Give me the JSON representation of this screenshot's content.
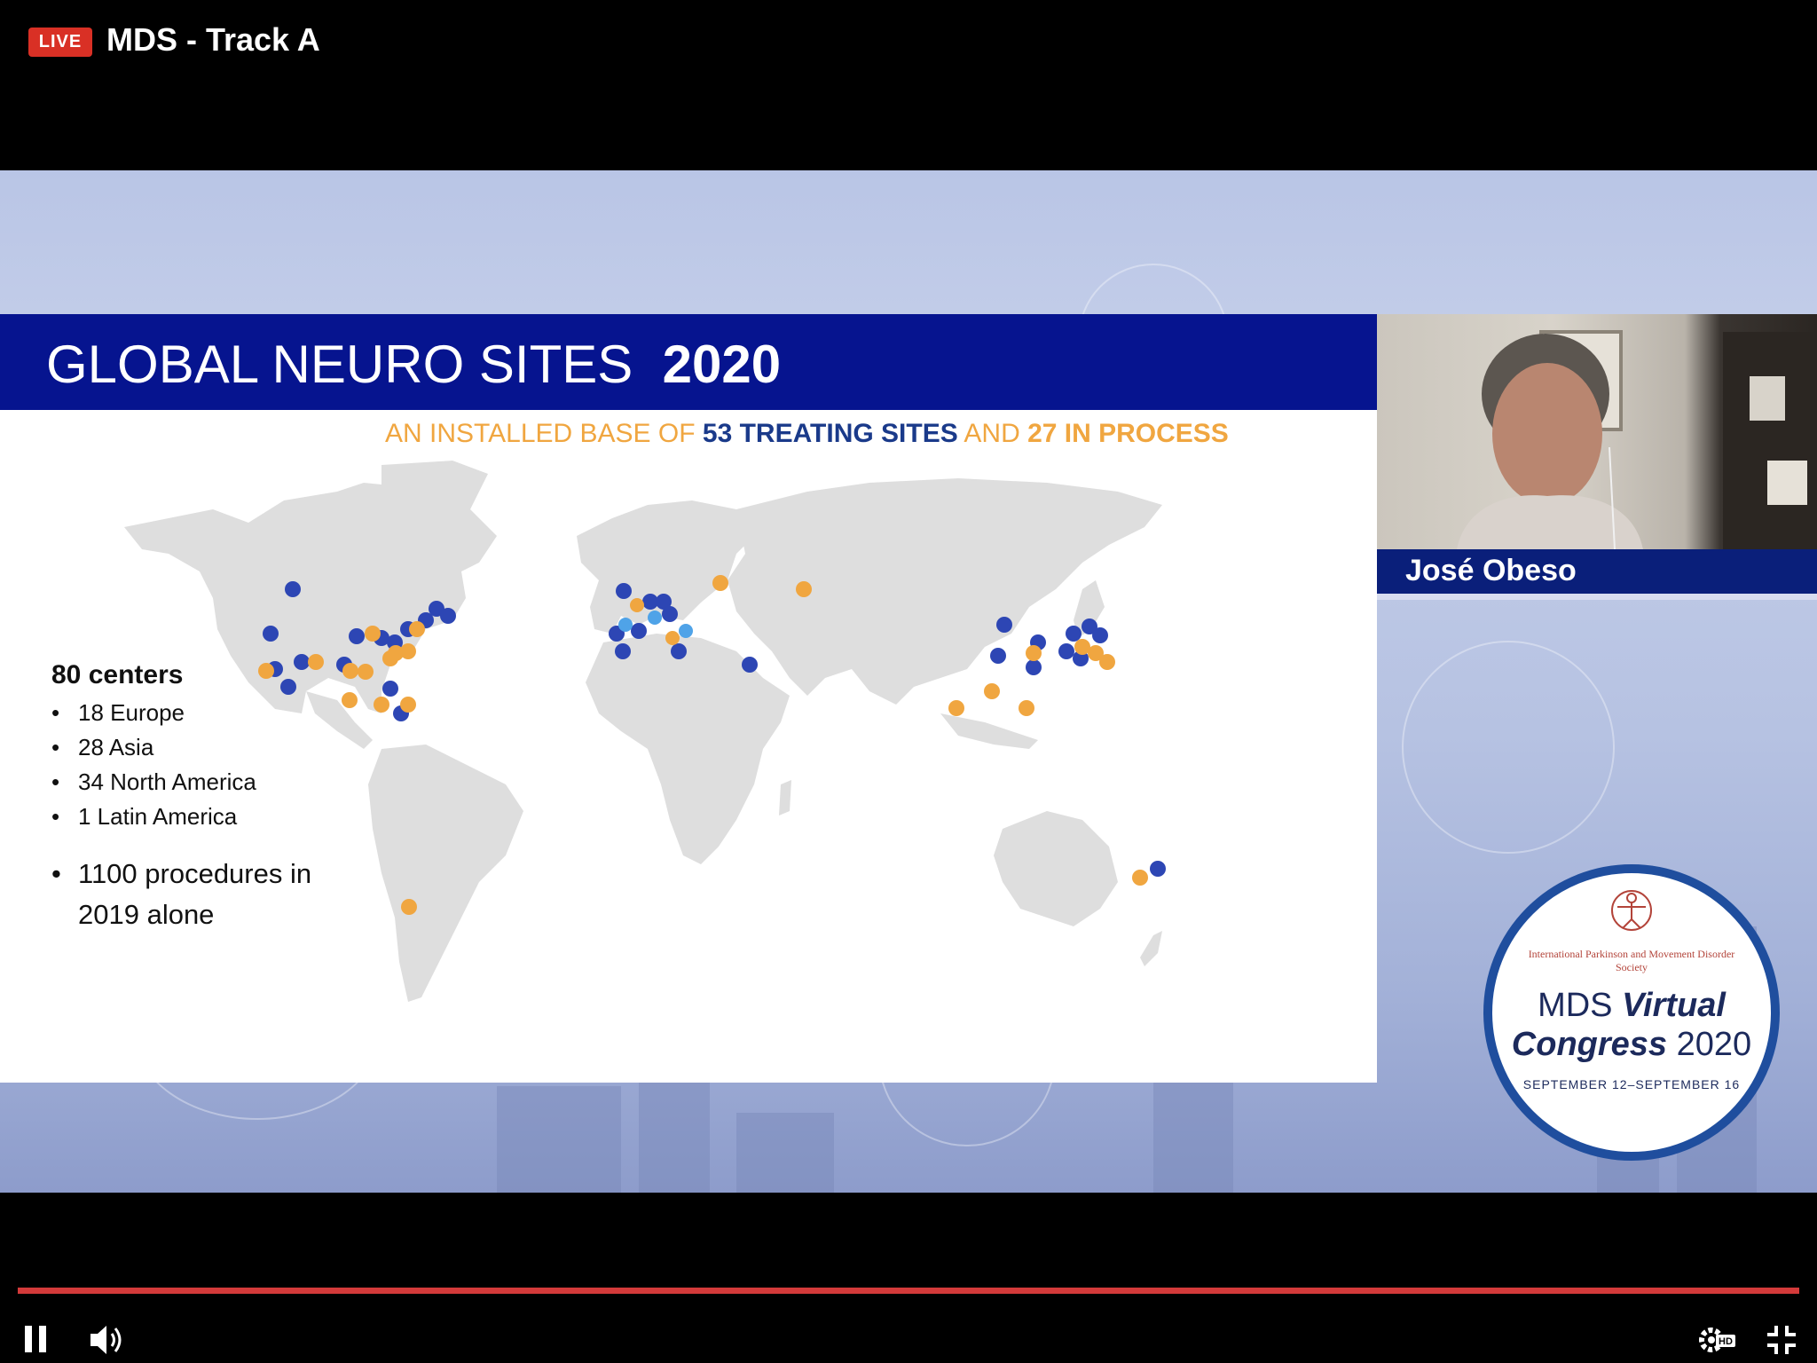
{
  "stream": {
    "live_label": "LIVE",
    "title": "MDS - Track A"
  },
  "slide": {
    "title": "GLOBAL NEURO SITES",
    "title_year": "2020",
    "subtitle_a": "AN INSTALLED BASE OF ",
    "subtitle_b": "53 TREATING SITES",
    "subtitle_c": " AND ",
    "subtitle_d": "27 IN PROCESS",
    "stats_heading": "80 centers",
    "stats_items": [
      "18 Europe",
      "28 Asia",
      "34 North America",
      "1 Latin America"
    ],
    "procedures": "1100 procedures in 2019 alone"
  },
  "speaker": {
    "name": "José Obeso"
  },
  "logo": {
    "society": "International Parkinson and Movement Disorder Society",
    "mds": "MDS",
    "virtual": "Virtual",
    "congress": "Congress",
    "year": "2020",
    "dates": "SEPTEMBER 12–SEPTEMBER 16"
  },
  "player": {
    "progress": 1.0,
    "quality_badge": "HD"
  },
  "colors": {
    "accent_live": "#d93025",
    "slide_header": "#06148f",
    "treating_site": "#2d46b4",
    "in_process_site": "#f0a640",
    "progress_bar": "#d33a3a"
  },
  "icons": [
    "pause-icon",
    "volume-icon",
    "settings-icon",
    "exit-fullscreen-icon"
  ]
}
